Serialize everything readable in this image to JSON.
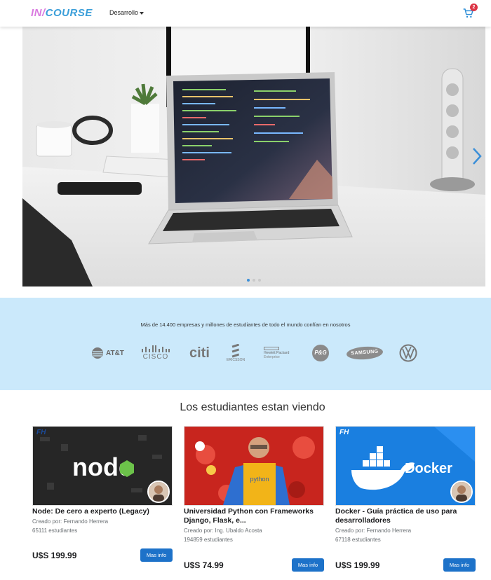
{
  "navbar": {
    "brand_part1": "IN",
    "brand_slash": "/",
    "brand_part2": "COURSE",
    "menu_label": "Desarrollo",
    "cart_icon": "cart-icon",
    "cart_count": "2"
  },
  "carousel": {
    "slide_count": 3,
    "active_slide": 1,
    "next_icon": "chevron-right-icon"
  },
  "companies": {
    "tagline": "Más de 14.400 empresas y millones de estudiantes de todo el mundo confían en nosotros",
    "logos": {
      "att": "AT&T",
      "cisco": "CISCO",
      "citi": "citi",
      "ericsson": "ERICSSON",
      "hpe_1": "Hewlett Packard",
      "hpe_2": "Enterprise",
      "pg": "P&G",
      "samsung": "SAMSUNG",
      "vw": "VW"
    }
  },
  "courses": {
    "section_title": "Los estudiantes estan viendo",
    "button_label": "Mas info",
    "items": [
      {
        "title": "Node: De cero a experto (Legacy)",
        "author": "Creado por: Fernando Herrera",
        "students": "65111 estudiantes",
        "price": "U$S 199.99",
        "thumb_text": "node"
      },
      {
        "title": "Universidad Python con Frameworks Django, Flask, e...",
        "author": "Creado por: Ing. Ubaldo Acosta",
        "students": "194859 estudiantes",
        "price": "U$S 74.99",
        "thumb_text": "python"
      },
      {
        "title": "Docker - Guía práctica de uso para desarrolladores",
        "author": "Creado por: Fernando Herrera",
        "students": "67118 estudiantes",
        "price": "U$S 199.99",
        "thumb_text": "Docker"
      }
    ]
  },
  "colors": {
    "brand_pink": "#d97ae0",
    "brand_blue": "#3a9ed9",
    "band_bg": "#cbe9fb",
    "button_bg": "#1d72c9",
    "badge_red": "#dc3545"
  }
}
